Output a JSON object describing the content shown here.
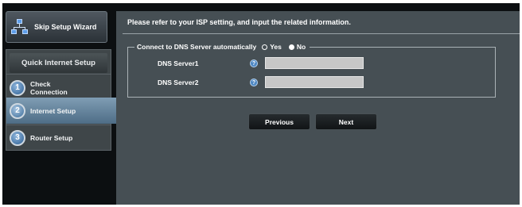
{
  "sidebar": {
    "skip_wizard_label": "Skip Setup Wizard",
    "panel_title": "Quick Internet Setup",
    "steps": [
      {
        "number": "1",
        "label_line1": "Check",
        "label_line2": "Connection"
      },
      {
        "number": "2",
        "label_line1": "Internet Setup",
        "label_line2": ""
      },
      {
        "number": "3",
        "label_line1": "Router Setup",
        "label_line2": ""
      }
    ],
    "active_step": 2
  },
  "main": {
    "info_text": "Please refer to your ISP setting, and input the related information.",
    "dns_group": {
      "legend": "Connect to DNS Server automatically",
      "options": [
        "Yes",
        "No"
      ],
      "selected": "No",
      "fields": [
        {
          "label": "DNS Server1",
          "value": "",
          "help": "?"
        },
        {
          "label": "DNS Server2",
          "value": "",
          "help": "?"
        }
      ]
    },
    "buttons": {
      "previous": "Previous",
      "next": "Next"
    }
  },
  "colors": {
    "background": "#0c0f11",
    "content_panel": "#464f54",
    "active_step": "#6e8ba2",
    "input_fill": "#c7c7c7"
  }
}
